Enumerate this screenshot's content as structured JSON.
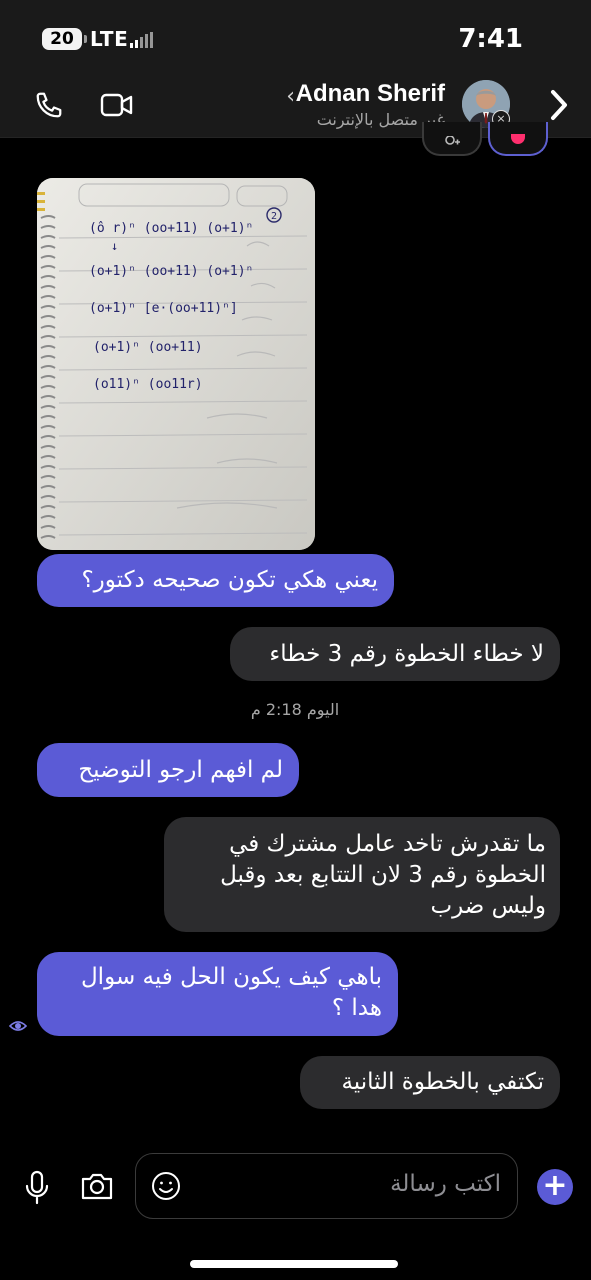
{
  "status_bar": {
    "battery": "20",
    "network": "LTE",
    "time": "7:41"
  },
  "header": {
    "contact_name": "Adnan Sherif",
    "contact_status": "غير متصل بالإنترنت",
    "back_chevron": "‹"
  },
  "icons": {
    "call": "phone-icon",
    "video": "video-camera-icon",
    "forward": "chevron-right-icon",
    "mic": "microphone-icon",
    "camera": "camera-icon",
    "emoji": "smiley-icon",
    "add": "plus-icon"
  },
  "photo_handwriting": {
    "lines": [
      "(ô r)ⁿ (oo+11) (o+1)ⁿ",
      "(o+1)ⁿ (oo+11) (o+1)ⁿ",
      "(o+1)ⁿ [e·(oo+11)ⁿ]",
      "(o+1)ⁿ (oo+11)",
      "(o11)ⁿ (oo11r)"
    ],
    "page_number": "2"
  },
  "messages": [
    {
      "from": "me",
      "text": "يعني هكي تكون صحيحه دكتور؟"
    },
    {
      "from": "them",
      "text": "لا خطاء الخطوة رقم 3 خطاء"
    },
    {
      "from": "me",
      "text": "لم افهم ارجو التوضيح"
    },
    {
      "from": "them",
      "text": "ما تقدرش تاخد عامل مشترك في\nالخطوة رقم 3 لان التتابع بعد وقبل\nوليس ضرب"
    },
    {
      "from": "me",
      "text": "باهي كيف يكون الحل فيه سوال\nهدا ؟"
    },
    {
      "from": "them",
      "text": "تكتفي بالخطوة الثانية"
    }
  ],
  "timestamp": "اليوم 2:18 م",
  "composer": {
    "placeholder": "اكتب رسالة",
    "add_label": "+"
  },
  "colors": {
    "sent_bubble": "#5b5bd6",
    "received_bubble": "#2c2c2e",
    "background": "#000000",
    "header": "#1a1a1a"
  }
}
